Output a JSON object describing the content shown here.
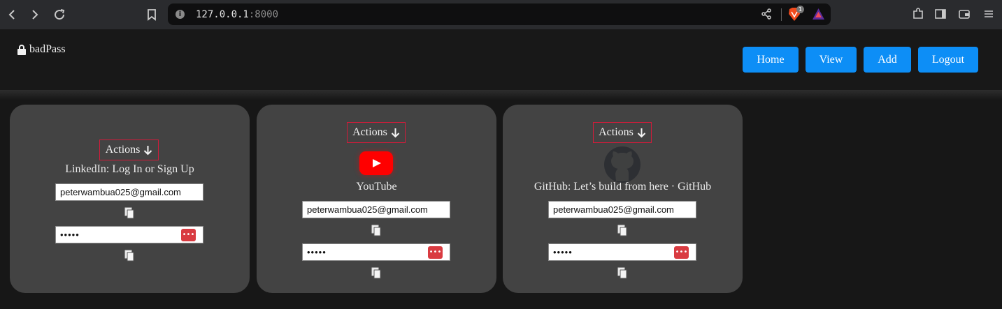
{
  "browser": {
    "url_host": "127.0.0.1",
    "url_port": ":8000",
    "badge_count": "1"
  },
  "app": {
    "brand": "badPass",
    "nav": [
      "Home",
      "View",
      "Add",
      "Logout"
    ],
    "colors": {
      "background": "#161616",
      "card": "#434343",
      "accent": "#0d8ef6",
      "actions_border": "#d31b3a"
    }
  },
  "cards": [
    {
      "actions": "Actions",
      "title": "LinkedIn: Log In or Sign Up",
      "email": "peterwambua025@gmail.com",
      "password_mask": "•••••",
      "key_icon": "•••"
    },
    {
      "actions": "Actions",
      "title": "YouTube",
      "email": "peterwambua025@gmail.com",
      "password_mask": "•••••",
      "key_icon": "•••"
    },
    {
      "actions": "Actions",
      "title": "GitHub: Let’s build from here · GitHub",
      "email": "peterwambua025@gmail.com",
      "password_mask": "•••••",
      "key_icon": "•••"
    }
  ]
}
